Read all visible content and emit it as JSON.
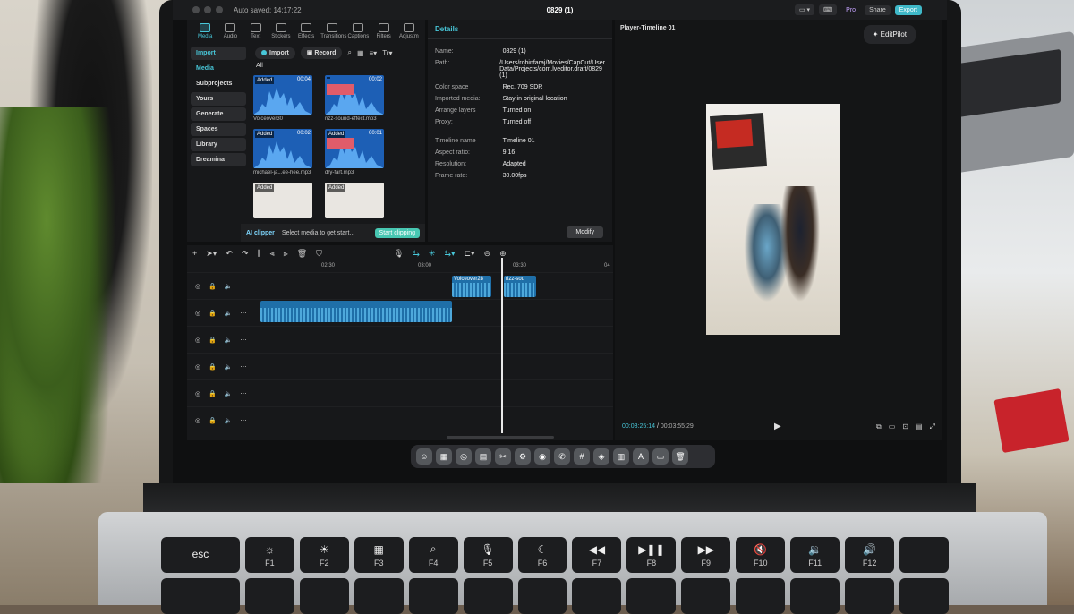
{
  "app": {
    "autosave": "Auto saved: 14:17:22",
    "title": "0829 (1)",
    "pro_label": "Pro",
    "share_label": "Share",
    "export_label": "Export"
  },
  "toolbar_tabs": [
    {
      "label": "Media",
      "active": true
    },
    {
      "label": "Audio"
    },
    {
      "label": "Text"
    },
    {
      "label": "Stickers"
    },
    {
      "label": "Effects"
    },
    {
      "label": "Transitions"
    },
    {
      "label": "Captions"
    },
    {
      "label": "Filters"
    },
    {
      "label": "Adjustm"
    }
  ],
  "sidebar": {
    "items": [
      {
        "label": "Import"
      },
      {
        "label": "Media"
      },
      {
        "label": "Subprojects"
      },
      {
        "label": "Yours"
      },
      {
        "label": "Generate"
      },
      {
        "label": "Spaces"
      },
      {
        "label": "Library"
      },
      {
        "label": "Dreamina"
      }
    ]
  },
  "media_toolbar": {
    "import_label": "Import",
    "record_label": "Record",
    "text_dropdown": "Tr"
  },
  "media": {
    "filter_label": "All",
    "tiles": [
      {
        "added": "Added",
        "duration": "00:04",
        "name": "Voiceover30"
      },
      {
        "added": "",
        "duration": "00:02",
        "name": "rizz-sound-effect.mp3"
      },
      {
        "added": "Added",
        "duration": "00:02",
        "name": "michael-ja...ee-hee.mp3"
      },
      {
        "added": "Added",
        "duration": "00:01",
        "name": "dry-fart.mp3"
      },
      {
        "added": "Added",
        "duration": "",
        "name": ""
      },
      {
        "added": "Added",
        "duration": "",
        "name": ""
      }
    ]
  },
  "ai_clipper": {
    "title": "AI clipper",
    "prompt": "Select media to get start...",
    "button": "Start clipping"
  },
  "details": {
    "heading": "Details",
    "rows": [
      {
        "key": "Name:",
        "value": "0829 (1)"
      },
      {
        "key": "Path:",
        "value": "/Users/robinfaraj/Movies/CapCut/User Data/Projects/com.lveditor.draft/0829 (1)"
      },
      {
        "key": "Color space",
        "value": "Rec. 709 SDR"
      },
      {
        "key": "Imported media:",
        "value": "Stay in original location"
      },
      {
        "key": "Arrange layers",
        "value": "Turned on"
      },
      {
        "key": "Proxy:",
        "value": "Turned off"
      },
      {
        "key": "Timeline name",
        "value": "Timeline 01"
      },
      {
        "key": "Aspect ratio:",
        "value": "9:16"
      },
      {
        "key": "Resolution:",
        "value": "Adapted"
      },
      {
        "key": "Frame rate:",
        "value": "30.00fps"
      }
    ],
    "modify_label": "Modify"
  },
  "player": {
    "title": "Player-Timeline 01",
    "editpilot_label": "EditPilot",
    "current_time": "00:03:25:14",
    "total_time": "00:03:55:29"
  },
  "timeline": {
    "ruler_labels": [
      "02:30",
      "03:00",
      "03:30",
      "04"
    ],
    "clips": [
      {
        "label": "Voiceover28"
      },
      {
        "label": "rizz-sou"
      }
    ]
  },
  "keyboard": {
    "row1": [
      {
        "sym": "esc",
        "fn": ""
      },
      {
        "sym": "☼",
        "fn": "F1"
      },
      {
        "sym": "☀",
        "fn": "F2"
      },
      {
        "sym": "▦",
        "fn": "F3"
      },
      {
        "sym": "⌕",
        "fn": "F4"
      },
      {
        "sym": "🎙",
        "fn": "F5"
      },
      {
        "sym": "☾",
        "fn": "F6"
      },
      {
        "sym": "◀◀",
        "fn": "F7"
      },
      {
        "sym": "▶❚❚",
        "fn": "F8"
      },
      {
        "sym": "▶▶",
        "fn": "F9"
      },
      {
        "sym": "🔇",
        "fn": "F10"
      },
      {
        "sym": "🔉",
        "fn": "F11"
      },
      {
        "sym": "🔊",
        "fn": "F12"
      },
      {
        "sym": "",
        "fn": ""
      }
    ]
  }
}
